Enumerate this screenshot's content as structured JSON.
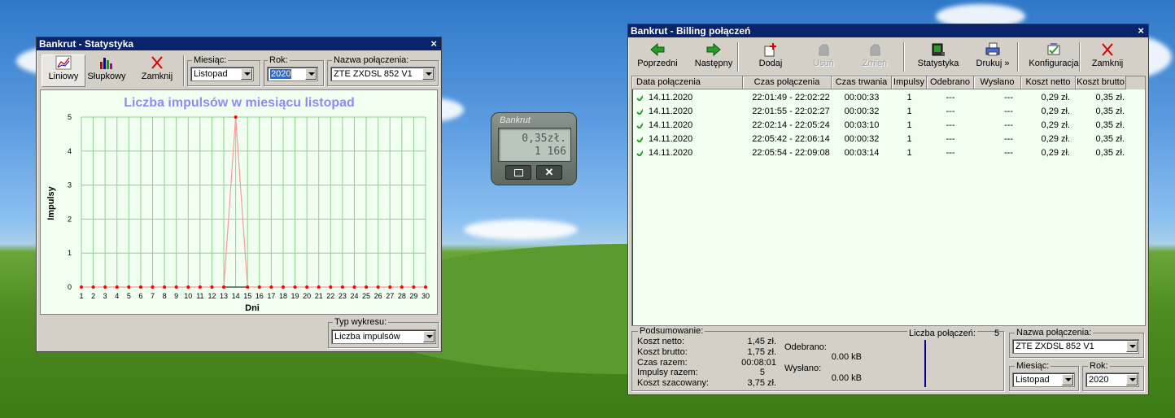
{
  "stat_window": {
    "title": "Bankrut - Statystyka",
    "toolbar": {
      "line_label": "Liniowy",
      "bar_label": "Słupkowy",
      "close_label": "Zamknij"
    },
    "month_label": "Miesiąc:",
    "month_value": "Listopad",
    "year_label": "Rok:",
    "year_value": "2020",
    "connection_label": "Nazwa połączenia:",
    "connection_value": "ZTE ZXDSL 852 V1",
    "chart_type_label": "Typ wykresu:",
    "chart_type_value": "Liczba impulsów"
  },
  "chart_data": {
    "type": "line",
    "title": "Liczba impulsów w miesiącu listopad",
    "xlabel": "Dni",
    "ylabel": "Impulsy",
    "x": [
      1,
      2,
      3,
      4,
      5,
      6,
      7,
      8,
      9,
      10,
      11,
      12,
      13,
      14,
      15,
      16,
      17,
      18,
      19,
      20,
      21,
      22,
      23,
      24,
      25,
      26,
      27,
      28,
      29,
      30
    ],
    "series": [
      {
        "values": [
          0,
          0,
          0,
          0,
          0,
          0,
          0,
          0,
          0,
          0,
          0,
          0,
          0,
          5,
          0,
          0,
          0,
          0,
          0,
          0,
          0,
          0,
          0,
          0,
          0,
          0,
          0,
          0,
          0,
          0
        ]
      }
    ],
    "ylim": [
      0,
      5
    ],
    "yticks": [
      "0",
      "1",
      "2",
      "3",
      "4",
      "5"
    ],
    "grid": true,
    "colors": {
      "line": "#ff9999",
      "marker": "#ff0000",
      "title": "#8c8cf5",
      "grid": "#90d090",
      "plot_bg": "#f0fff0"
    }
  },
  "mini_widget": {
    "title": "Bankrut",
    "cost": "0,35zł.",
    "counter": "1 166"
  },
  "billing_window": {
    "title": "Bankrut - Billing połączeń",
    "toolbar": [
      {
        "label": "Poprzedni",
        "icon": "arrow-left-icon",
        "enabled": true
      },
      {
        "label": "Następny",
        "icon": "arrow-right-icon",
        "enabled": true
      },
      {
        "label": "Dodaj",
        "icon": "add-icon",
        "enabled": true
      },
      {
        "label": "Usuń",
        "icon": "delete-icon",
        "enabled": false
      },
      {
        "label": "Zmień",
        "icon": "edit-icon",
        "enabled": false
      },
      {
        "label": "Statystyka",
        "icon": "chart-icon",
        "enabled": true
      },
      {
        "label": "Drukuj »",
        "icon": "printer-icon",
        "enabled": true
      },
      {
        "label": "Konfiguracja",
        "icon": "config-icon",
        "enabled": true
      },
      {
        "label": "Zamknij",
        "icon": "close-icon",
        "enabled": true
      }
    ],
    "columns": [
      "Data połączenia",
      "Czas połączenia",
      "Czas trwania",
      "Impulsy",
      "Odebrano",
      "Wysłano",
      "Koszt netto",
      "Koszt brutto"
    ],
    "rows": [
      [
        "14.11.2020",
        "22:01:49 - 22:02:22",
        "00:00:33",
        "1",
        "---",
        "---",
        "0,29 zł.",
        "0,35 zł."
      ],
      [
        "14.11.2020",
        "22:01:55 - 22:02:27",
        "00:00:32",
        "1",
        "---",
        "---",
        "0,29 zł.",
        "0,35 zł."
      ],
      [
        "14.11.2020",
        "22:02:14 - 22:05:24",
        "00:03:10",
        "1",
        "---",
        "---",
        "0,29 zł.",
        "0,35 zł."
      ],
      [
        "14.11.2020",
        "22:05:42 - 22:06:14",
        "00:00:32",
        "1",
        "---",
        "---",
        "0,29 zł.",
        "0,35 zł."
      ],
      [
        "14.11.2020",
        "22:05:54 - 22:09:08",
        "00:03:14",
        "1",
        "---",
        "---",
        "0,29 zł.",
        "0,35 zł."
      ]
    ],
    "summary": {
      "title": "Podsumowanie:",
      "net_label": "Koszt netto:",
      "net_value": "1,45 zł.",
      "gross_label": "Koszt brutto:",
      "gross_value": "1,75 zł.",
      "time_label": "Czas razem:",
      "time_value": "00:08:01",
      "impulses_label": "Impulsy razem:",
      "impulses_value": "5",
      "estimated_label": "Koszt szacowany:",
      "estimated_value": "3,75 zł.",
      "received_label": "Odebrano:",
      "received_value": "0.00 kB",
      "sent_label": "Wysłano:",
      "sent_value": "0.00 kB",
      "count_label": "Liczba połączeń:",
      "count_value": "5"
    },
    "connection_label": "Nazwa połączenia:",
    "connection_value": "ZTE ZXDSL 852 V1",
    "month_label": "Miesiąc:",
    "month_value": "Listopad",
    "year_label": "Rok:",
    "year_value": "2020"
  }
}
